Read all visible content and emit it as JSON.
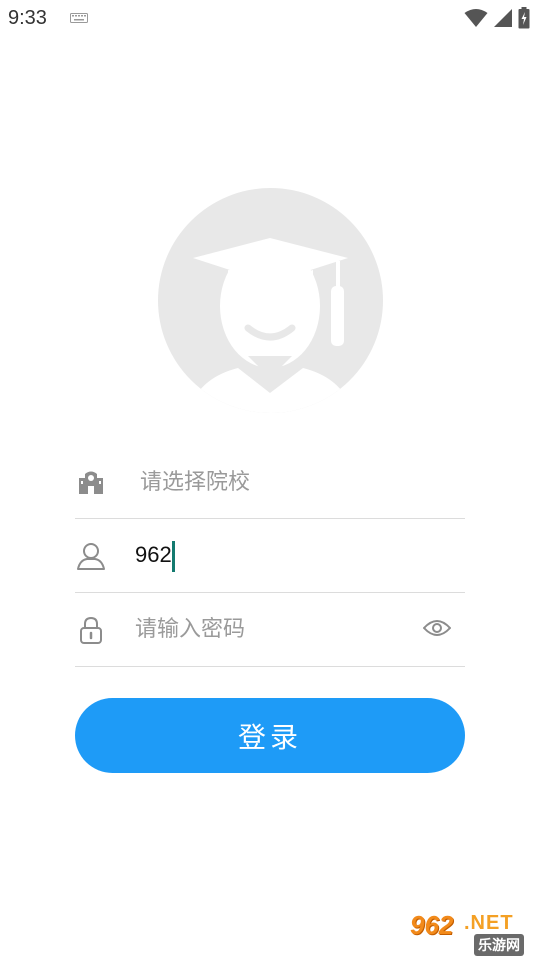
{
  "status_bar": {
    "time": "9:33"
  },
  "login": {
    "school_placeholder": "请选择院校",
    "username_value": "962",
    "password_placeholder": "请输入密码",
    "login_label": "登录"
  },
  "watermark": {
    "number": "962",
    "suffix": ".NET",
    "chinese": "乐游网"
  },
  "colors": {
    "accent": "#1e9bf7",
    "cursor": "#137a6f",
    "icon_gray": "#8c8c8c",
    "placeholder": "#9a9a9a"
  },
  "icons": {
    "school": "school-building-icon",
    "user": "user-icon",
    "lock": "lock-icon",
    "eye": "eye-icon",
    "avatar": "graduate-avatar-icon"
  }
}
